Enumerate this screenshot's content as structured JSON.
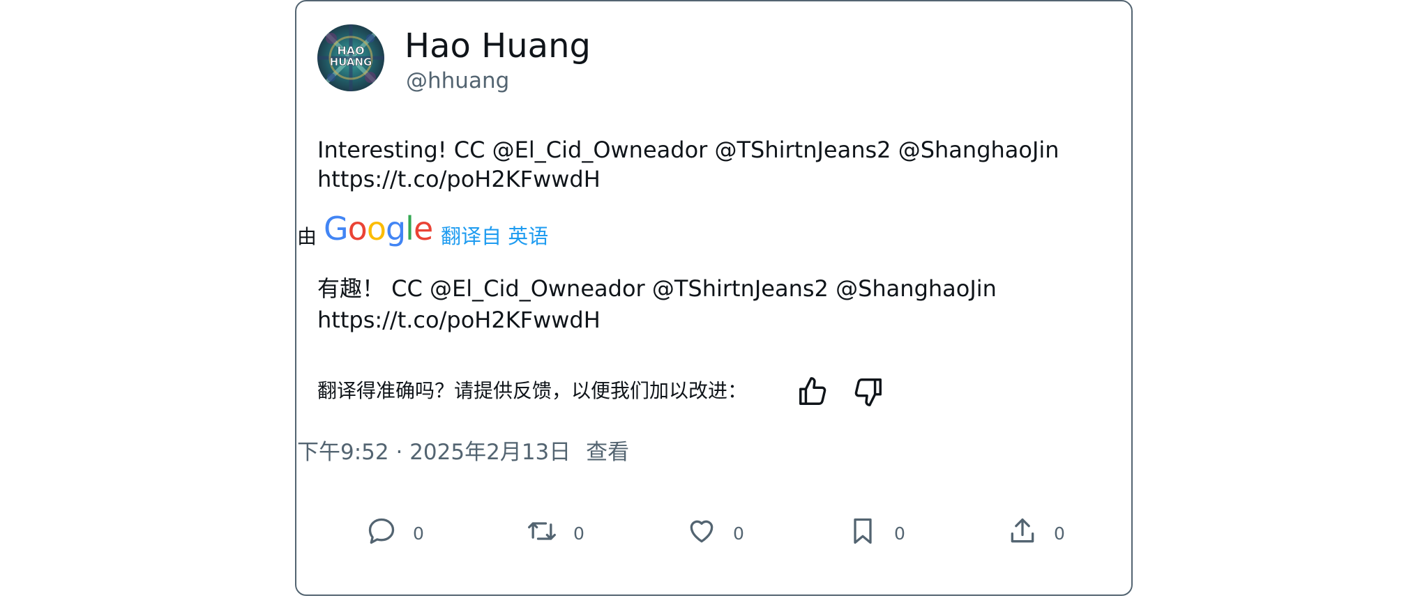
{
  "author": {
    "display_name": "Hao Huang",
    "handle": "@hhuang",
    "avatar_text_line1": "HAO",
    "avatar_text_line2": "HUANG"
  },
  "tweet": {
    "text": "Interesting! CC @El_Cid_Owneador @TShirtnJeans2 @ShanghaoJin\nhttps://t.co/poH2KFwwdH"
  },
  "translation": {
    "by_label": "由",
    "provider": "Google",
    "translated_from": "翻译自 英语",
    "text": "有趣！ CC @El_Cid_Owneador @TShirtnJeans2 @ShanghaoJin\nhttps://t.co/poH2KFwwdH",
    "feedback_prompt": "翻译得准确吗？请提供反馈，以便我们加以改进："
  },
  "meta": {
    "time": "下午9:52",
    "separator": "·",
    "date": "2025年2月13日",
    "view_label": "查看"
  },
  "actions": {
    "reply_count": "0",
    "retweet_count": "0",
    "like_count": "0",
    "bookmark_count": "0",
    "share_count": "0"
  },
  "colors": {
    "text_primary": "#0f1419",
    "text_secondary": "#536471",
    "link": "#1d9bf0",
    "border": "#536471"
  }
}
